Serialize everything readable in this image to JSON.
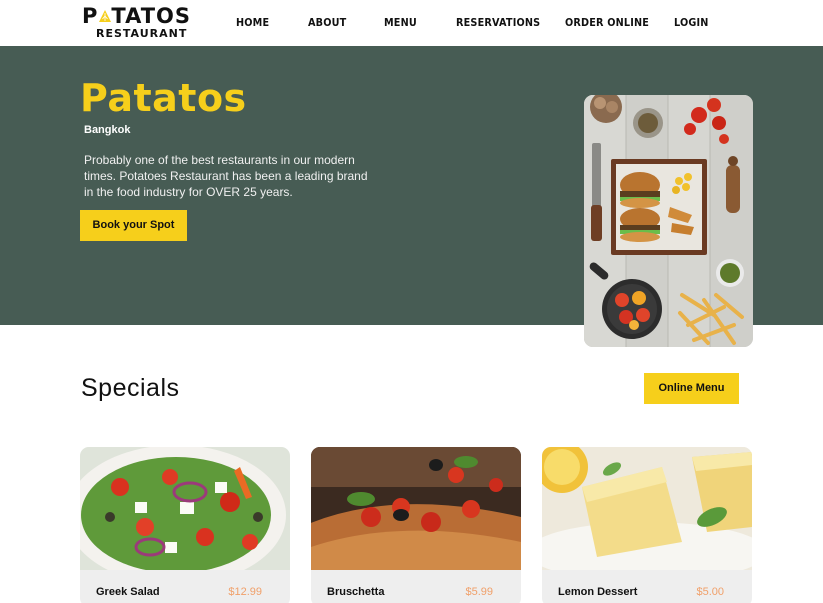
{
  "brand": {
    "name": "PATATOS",
    "sub": "RESTAURANT",
    "accent": "#f6cf1b"
  },
  "nav": {
    "items": [
      "HOME",
      "ABOUT",
      "MENU",
      "RESERVATIONS",
      "ORDER ONLINE",
      "LOGIN"
    ]
  },
  "hero": {
    "title": "Patatos",
    "location": "Bangkok",
    "description": "Probably one of the best restaurants in our modern times. Potatoes Restaurant has been a leading brand in the food industry for OVER 25 years.",
    "button": "Book your Spot",
    "background": "#475c54"
  },
  "specials": {
    "title": "Specials",
    "button": "Online Menu",
    "cards": [
      {
        "name": "Greek Salad",
        "price": "$12.99"
      },
      {
        "name": "Bruschetta",
        "price": "$5.99"
      },
      {
        "name": "Lemon Dessert",
        "price": "$5.00"
      }
    ]
  }
}
